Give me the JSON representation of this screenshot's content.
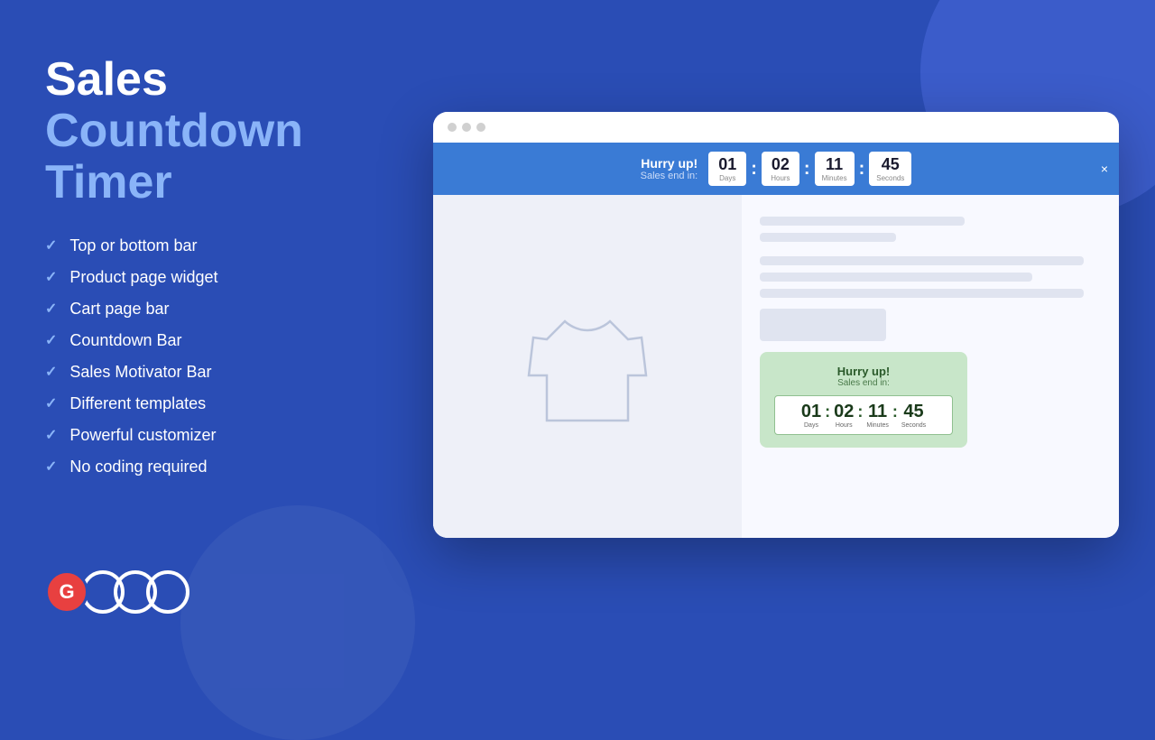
{
  "background": {
    "color": "#2a4db5"
  },
  "title": {
    "part1": "Sales",
    "part2": "Countdown",
    "part3": "Timer"
  },
  "features": [
    {
      "id": "top-bottom-bar",
      "label": "Top or bottom bar"
    },
    {
      "id": "product-page-widget",
      "label": "Product page widget"
    },
    {
      "id": "cart-page-bar",
      "label": "Cart page bar"
    },
    {
      "id": "countdown-bar",
      "label": "Countdown Bar"
    },
    {
      "id": "sales-motivator-bar",
      "label": "Sales Motivator Bar"
    },
    {
      "id": "different-templates",
      "label": "Different templates"
    },
    {
      "id": "powerful-customizer",
      "label": "Powerful customizer"
    },
    {
      "id": "no-coding-required",
      "label": "No coding required"
    }
  ],
  "browser": {
    "dots": [
      "dot1",
      "dot2",
      "dot3"
    ]
  },
  "countdown_bar": {
    "hurry_up": "Hurry up!",
    "sales_end": "Sales end in:",
    "days": "01",
    "hours": "02",
    "minutes": "11",
    "seconds": "45",
    "days_label": "Days",
    "hours_label": "Hours",
    "minutes_label": "Minutes",
    "seconds_label": "Seconds",
    "close": "×"
  },
  "widget": {
    "hurry_up": "Hurry up!",
    "sales_end": "Sales end in:",
    "days": "01",
    "hours": "02",
    "minutes": "11",
    "seconds": "45",
    "days_label": "Days",
    "hours_label": "Hours",
    "minutes_label": "Minutes",
    "seconds_label": "Seconds"
  },
  "logo": {
    "letter": "G"
  }
}
